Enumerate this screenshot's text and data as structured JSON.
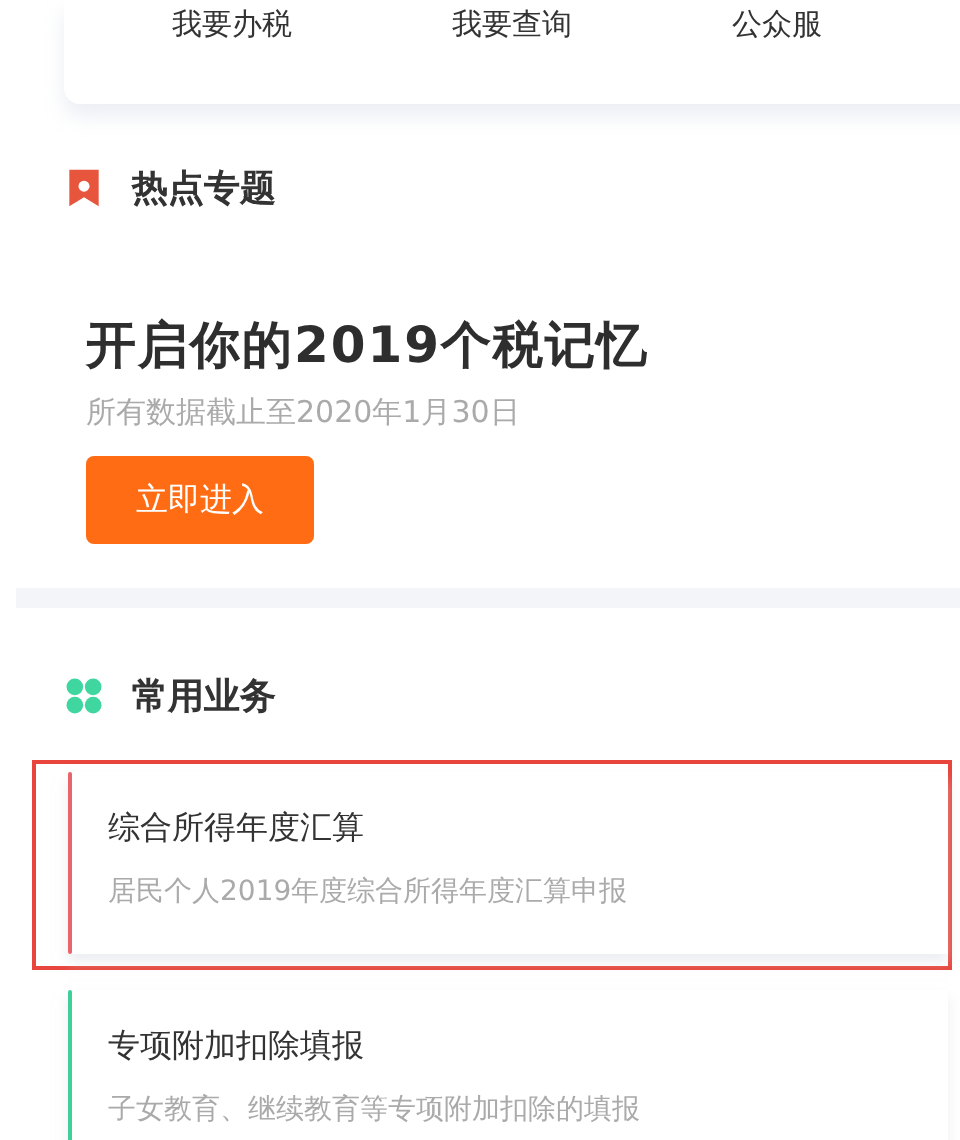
{
  "quick_nav": [
    {
      "label": "我要办税"
    },
    {
      "label": "我要查询"
    },
    {
      "label": "公众服"
    }
  ],
  "hot_topics": {
    "title": "热点专题",
    "banner_title": "开启你的2019个税记忆",
    "banner_subtitle": "所有数据截止至2020年1月30日",
    "button": "立即进入"
  },
  "common_services": {
    "title": "常用业务",
    "items": [
      {
        "title": "综合所得年度汇算",
        "subtitle": "居民个人2019年度综合所得年度汇算申报",
        "color": "#e8656a",
        "highlighted": true
      },
      {
        "title": "专项附加扣除填报",
        "subtitle": "子女教育、继续教育等专项附加扣除的填报",
        "color": "#3fcf9a",
        "highlighted": false
      }
    ]
  }
}
